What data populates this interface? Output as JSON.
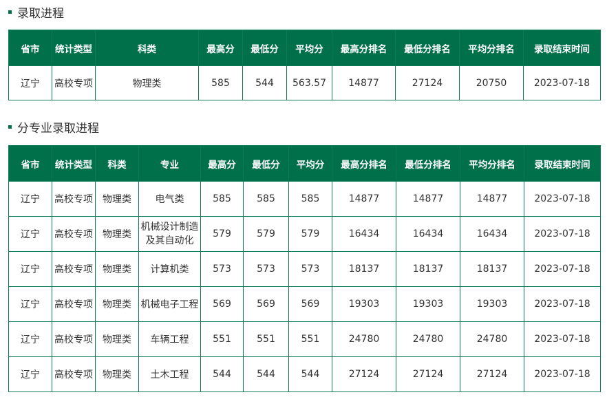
{
  "section1": {
    "title": "录取进程",
    "headers": [
      "省市",
      "统计类型",
      "科类",
      "最高分",
      "最低分",
      "平均分",
      "最高分排名",
      "最低分排名",
      "平均分排名",
      "录取结束时间"
    ],
    "rows": [
      [
        "辽宁",
        "高校专项",
        "物理类",
        "585",
        "544",
        "563.57",
        "14877",
        "27124",
        "20750",
        "2023-07-18"
      ]
    ]
  },
  "section2": {
    "title": "分专业录取进程",
    "headers": [
      "省市",
      "统计类型",
      "科类",
      "专业",
      "最高分",
      "最低分",
      "平均分",
      "最高分排名",
      "最低分排名",
      "平均分排名",
      "录取结束时间"
    ],
    "rows": [
      [
        "辽宁",
        "高校专项",
        "物理类",
        "电气类",
        "585",
        "585",
        "585",
        "14877",
        "14877",
        "14877",
        "2023-07-18"
      ],
      [
        "辽宁",
        "高校专项",
        "物理类",
        "机械设计制造及其自动化",
        "579",
        "579",
        "579",
        "16434",
        "16434",
        "16434",
        "2023-07-18"
      ],
      [
        "辽宁",
        "高校专项",
        "物理类",
        "计算机类",
        "573",
        "573",
        "573",
        "18137",
        "18137",
        "18137",
        "2023-07-18"
      ],
      [
        "辽宁",
        "高校专项",
        "物理类",
        "机械电子工程",
        "569",
        "569",
        "569",
        "19303",
        "19303",
        "19303",
        "2023-07-18"
      ],
      [
        "辽宁",
        "高校专项",
        "物理类",
        "车辆工程",
        "551",
        "551",
        "551",
        "24780",
        "24780",
        "24780",
        "2023-07-18"
      ],
      [
        "辽宁",
        "高校专项",
        "物理类",
        "土木工程",
        "544",
        "544",
        "544",
        "27124",
        "27124",
        "27124",
        "2023-07-18"
      ]
    ]
  },
  "colors": {
    "header_bg": "#00704a",
    "border": "#0b7a55",
    "marker": "#00704a"
  }
}
